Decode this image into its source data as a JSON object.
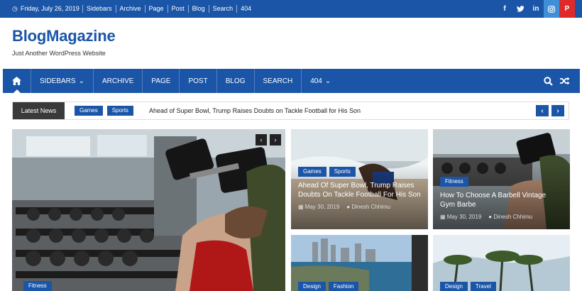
{
  "topbar": {
    "date": "Friday, July 26, 2019",
    "links": [
      "Sidebars",
      "Archive",
      "Page",
      "Post",
      "Blog",
      "Search",
      "404"
    ],
    "social": [
      {
        "name": "facebook-icon",
        "glyph": "f",
        "color": "#3b5998"
      },
      {
        "name": "twitter-icon",
        "glyph": "t",
        "color": "#1da1f2"
      },
      {
        "name": "linkedin-icon",
        "glyph": "in",
        "color": "#0077b5"
      },
      {
        "name": "instagram-icon",
        "glyph": "◎",
        "color": "#3f729b"
      },
      {
        "name": "pinterest-icon",
        "glyph": "p",
        "color": "#e60023"
      }
    ]
  },
  "brand": {
    "title": "BlogMagazine",
    "tagline": "Just Another WordPress Website"
  },
  "nav": {
    "items": [
      "SIDEBARS",
      "ARCHIVE",
      "PAGE",
      "POST",
      "BLOG",
      "SEARCH",
      "404"
    ]
  },
  "ticker": {
    "label": "Latest News",
    "tags": [
      "Games",
      "Sports"
    ],
    "headline": "Ahead of Super Bowl, Trump Raises Doubts on Tackle Football for His Son"
  },
  "cards": {
    "main": {
      "tag": "Fitness"
    },
    "card1": {
      "tags": [
        "Games",
        "Sports"
      ],
      "title": "Ahead Of Super Bowl, Trump Raises Doubts On Tackle Football For His Son",
      "date": "May 30, 2019",
      "author": "Dinesh Chhimu"
    },
    "card2": {
      "tags": [
        "Fitness"
      ],
      "title": "How To Choose A Barbell Vintage Gym Barbe",
      "date": "May 30, 2019",
      "author": "Dinesh Chhimu"
    },
    "card3": {
      "tags": [
        "Design",
        "Fashion"
      ]
    },
    "card4": {
      "tags": [
        "Design",
        "Travel"
      ]
    }
  },
  "colors": {
    "brand": "#1a55a8",
    "label_bg": "#3a3a3a"
  }
}
